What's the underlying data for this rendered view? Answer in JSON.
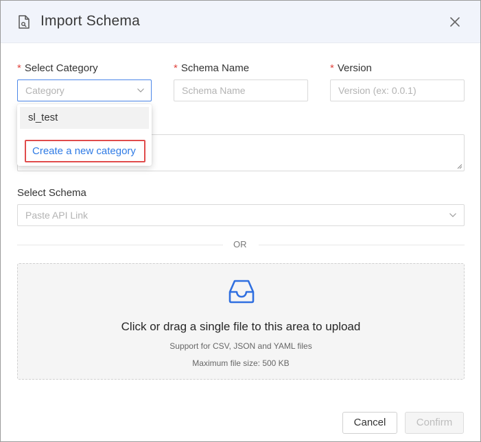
{
  "dialog": {
    "title": "Import Schema",
    "title_icon": "document-icon",
    "close_icon": "close-icon"
  },
  "fields": {
    "category": {
      "label": "Select Category",
      "required_mark": "*",
      "placeholder": "Category"
    },
    "schema_name": {
      "label": "Schema Name",
      "required_mark": "*",
      "placeholder": "Schema Name"
    },
    "version": {
      "label": "Version",
      "required_mark": "*",
      "placeholder": "Version (ex: 0.0.1)"
    }
  },
  "category_dropdown": {
    "options": [
      "sl_test"
    ],
    "create_label": "Create a new category"
  },
  "schema_select": {
    "label": "Select Schema",
    "placeholder": "Paste API Link"
  },
  "divider_text": "OR",
  "upload": {
    "icon": "inbox-icon",
    "main_text": "Click or drag a single file to this area to upload",
    "support_text": "Support for CSV, JSON and YAML files",
    "size_text": "Maximum file size: 500 KB"
  },
  "footer": {
    "cancel_label": "Cancel",
    "confirm_label": "Confirm"
  },
  "colors": {
    "accent": "#2f7be5",
    "required": "#e0453f",
    "highlight_border": "#e04b4b",
    "upload_icon": "#2f6fe0"
  }
}
